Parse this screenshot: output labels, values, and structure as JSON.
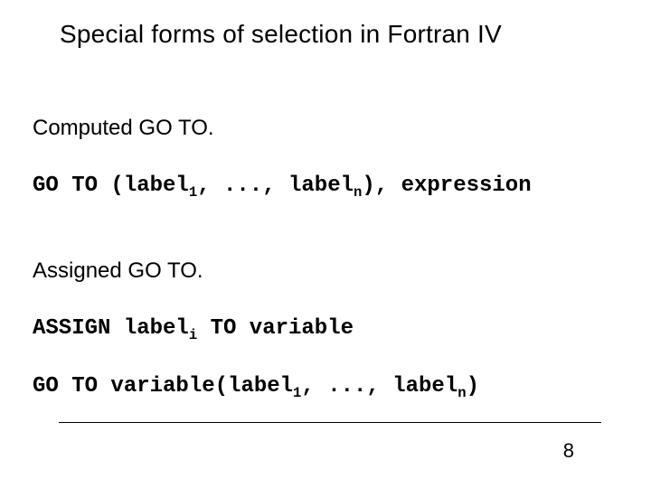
{
  "title": "Special forms of selection in Fortran IV",
  "section1": "Computed GO TO.",
  "code1": {
    "prefix": "GO TO (label",
    "sub1": "1",
    "mid": ", ..., label",
    "subn": "n",
    "suffix": "), expression"
  },
  "section2": "Assigned GO TO.",
  "code2": {
    "prefix": "ASSIGN label",
    "subi": "i",
    "suffix": " TO variable"
  },
  "code3": {
    "prefix": "GO TO variable(label",
    "sub1": "1",
    "mid": ", ..., label",
    "subn": "n",
    "suffix": ")"
  },
  "page": "8"
}
